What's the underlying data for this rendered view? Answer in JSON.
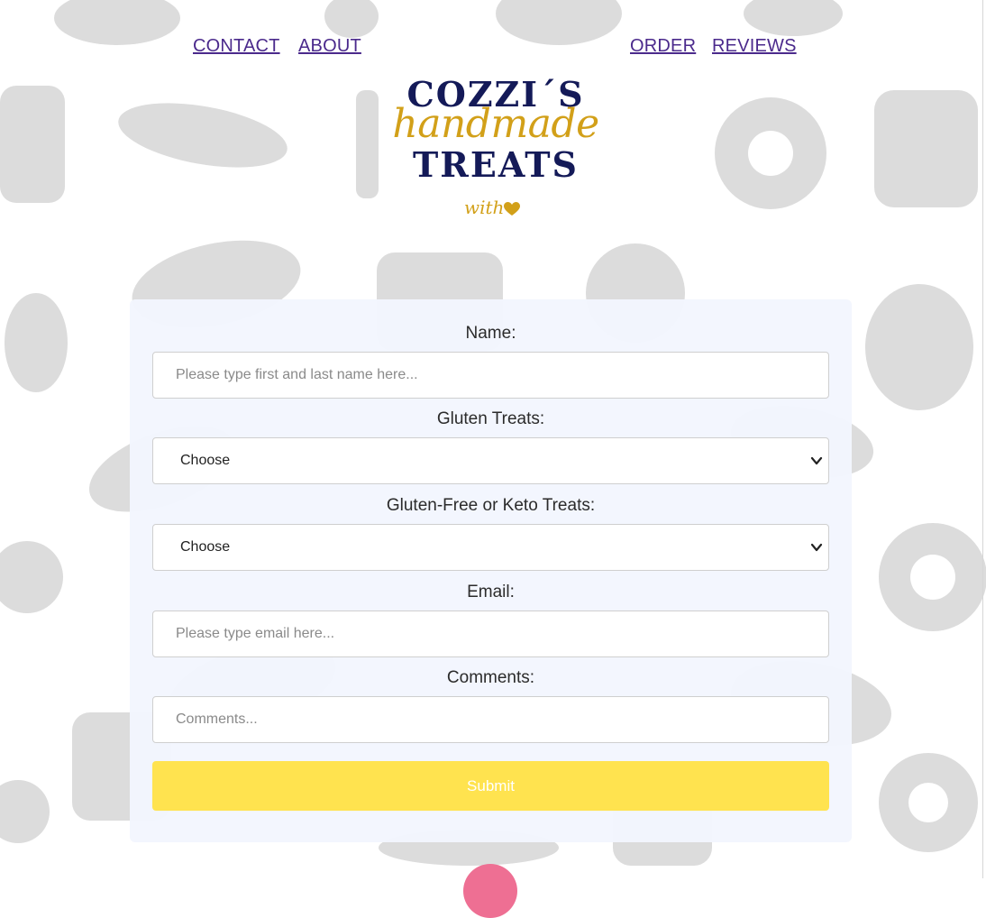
{
  "nav": {
    "contact": "CONTACT",
    "about": "ABOUT",
    "order": "ORDER",
    "reviews": "REVIEWS"
  },
  "logo": {
    "line1": "COZZI´S",
    "line2": "handmade",
    "line3": "TREATS",
    "line4": "with"
  },
  "form": {
    "name_label": "Name:",
    "name_placeholder": "Please type first and last name here...",
    "gluten_label": "Gluten Treats:",
    "gluten_selected": "Choose",
    "glutenfree_label": "Gluten-Free or Keto Treats:",
    "glutenfree_selected": "Choose",
    "email_label": "Email:",
    "email_placeholder": "Please type email here...",
    "comments_label": "Comments:",
    "comments_placeholder": "Comments...",
    "submit_label": "Submit"
  },
  "colors": {
    "link": "#4b2a8c",
    "logo_navy": "#141a58",
    "logo_gold": "#d2a019",
    "submit": "#ffe34f",
    "card": "#f2f6fe",
    "background_icons": "#d9d9d9"
  }
}
